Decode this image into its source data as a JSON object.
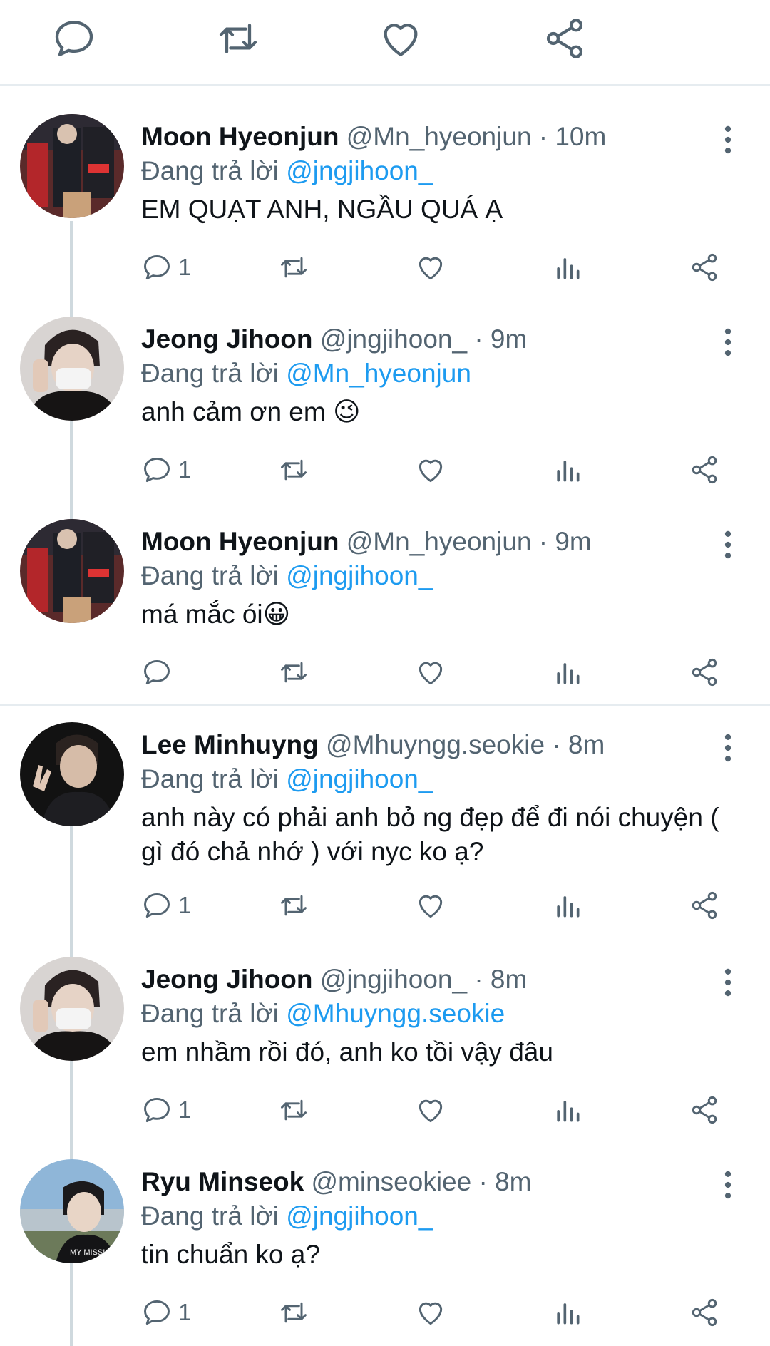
{
  "top_actions": [
    "reply-icon",
    "retweet-icon",
    "like-icon",
    "share-icon"
  ],
  "colors": {
    "accent": "#1d9bf0",
    "secondary_text": "#536471",
    "icon": "#536471",
    "divider": "#e6ecf0"
  },
  "tweets": [
    {
      "name": "Moon Hyeonjun",
      "meta": "@Mn_hyeonjun · 10m",
      "reply_prefix": "Đang trả lời",
      "mention": "@jngjihoon_",
      "text": "EM QUẠT ANH,  NGẦU QUÁ Ạ",
      "reply_count": "1"
    },
    {
      "name": "Jeong Jihoon",
      "meta": "@jngjihoon_ · 9m",
      "reply_prefix": "Đang trả lời",
      "mention": "@Mn_hyeonjun",
      "text": "anh cảm ơn em 😉",
      "reply_count": "1"
    },
    {
      "name": "Moon Hyeonjun",
      "meta": "@Mn_hyeonjun · 9m",
      "reply_prefix": "Đang trả lời",
      "mention": "@jngjihoon_",
      "text": "má mắc ói😀",
      "reply_count": ""
    },
    {
      "name": "Lee Minhuyng",
      "meta": "@Mhuyngg.seokie · 8m",
      "reply_prefix": "Đang trả lời",
      "mention": "@jngjihoon_",
      "text": "anh này có phải anh bỏ ng đẹp để đi nói chuyện ( gì đó chả nhớ ) với nyc ko ạ?",
      "reply_count": "1"
    },
    {
      "name": "Jeong Jihoon",
      "meta": "@jngjihoon_ · 8m",
      "reply_prefix": "Đang trả lời",
      "mention": "@Mhuyngg.seokie",
      "text": "em nhầm rồi đó, anh ko tồi vậy đâu",
      "reply_count": "1"
    },
    {
      "name": "Ryu Minseok",
      "meta": "@minseokiee · 8m",
      "reply_prefix": "Đang trả lời",
      "mention": "@jngjihoon_",
      "text": "tin chuẩn ko ạ?",
      "reply_count": "1"
    }
  ]
}
